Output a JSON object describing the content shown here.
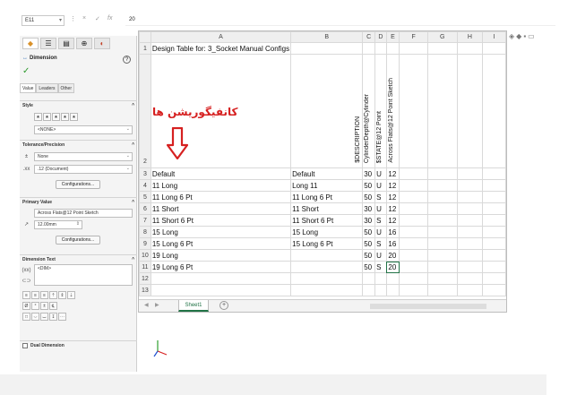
{
  "formula_bar": {
    "name_box": "E11",
    "cancel_symbol": "×",
    "enter_symbol": "✓",
    "fx_symbol": "fx",
    "value": "20"
  },
  "property_manager": {
    "title": "Dimension",
    "help": "?",
    "subtabs": [
      "Value",
      "Leaders",
      "Other"
    ],
    "style": {
      "header": "Style",
      "selected": "<NONE>"
    },
    "tolerance": {
      "header": "Tolerance/Precision",
      "tolerance_type": "None",
      "precision": ".12 (Document)",
      "configs_button": "Configurations..."
    },
    "primary_value": {
      "header": "Primary Value",
      "name": "Across Flats@12 Point Sketch",
      "value": "12.00mm",
      "configs_button": "Configurations..."
    },
    "dimension_text": {
      "header": "Dimension Text",
      "value": "<DIM>"
    },
    "dual_dimension": "Dual Dimension"
  },
  "sheet": {
    "columns": [
      "A",
      "B",
      "C",
      "D",
      "E",
      "F",
      "G",
      "H",
      "I"
    ],
    "rows": [
      {
        "n": "1",
        "A": "Design Table for: 3_Socket Manual Configs",
        "B": "",
        "C": "",
        "D": "",
        "E": ""
      },
      {
        "n": "2",
        "A": "",
        "B": "",
        "C": "CylinderDepth@Cylinder",
        "D": "$STATE@12 Point",
        "E": "Across Flats@12 Point Sketch",
        "B2": "$DESCRIPTION"
      },
      {
        "n": "3",
        "A": "Default",
        "B": "Default",
        "C": "30",
        "D": "U",
        "E": "12"
      },
      {
        "n": "4",
        "A": "11 Long",
        "B": "Long 11",
        "C": "50",
        "D": "U",
        "E": "12"
      },
      {
        "n": "5",
        "A": "11 Long 6 Pt",
        "B": "11 Long 6 Pt",
        "C": "50",
        "D": "S",
        "E": "12"
      },
      {
        "n": "6",
        "A": "11 Short",
        "B": "11 Short",
        "C": "30",
        "D": "U",
        "E": "12"
      },
      {
        "n": "7",
        "A": "11 Short 6 Pt",
        "B": "11 Short 6 Pt",
        "C": "30",
        "D": "S",
        "E": "12"
      },
      {
        "n": "8",
        "A": "15 Long",
        "B": "15 Long",
        "C": "50",
        "D": "U",
        "E": "16"
      },
      {
        "n": "9",
        "A": "15 Long 6 Pt",
        "B": "15 Long 6 Pt",
        "C": "50",
        "D": "S",
        "E": "16"
      },
      {
        "n": "10",
        "A": "19 Long",
        "B": "",
        "C": "50",
        "D": "U",
        "E": "20"
      },
      {
        "n": "11",
        "A": "19 Long 6 Pt",
        "B": "",
        "C": "50",
        "D": "S",
        "E": "20"
      },
      {
        "n": "12",
        "A": "",
        "B": "",
        "C": "",
        "D": "",
        "E": ""
      },
      {
        "n": "13",
        "A": "",
        "B": "",
        "C": "",
        "D": "",
        "E": ""
      }
    ],
    "sheet_tab": "Sheet1",
    "add_sheet": "+"
  },
  "annotation": {
    "text": "کانفیگوریشن ها",
    "color": "#d62020"
  },
  "colors": {
    "accent": "#217346",
    "annotation_red": "#d62020"
  }
}
